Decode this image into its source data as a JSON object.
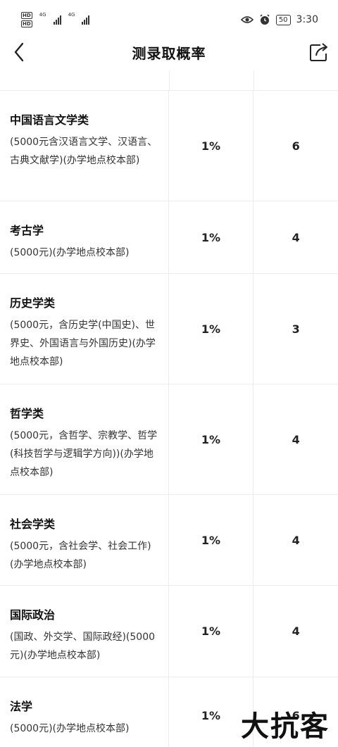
{
  "status_bar": {
    "hd1": "HD",
    "hd2": "HD",
    "net1": "4G",
    "net2": "4G",
    "battery": "50",
    "time": "3:30",
    "icons": [
      "eye-icon",
      "alarm-icon"
    ]
  },
  "header": {
    "title": "测录取概率",
    "back_icon": "chevron-left-icon",
    "share_icon": "share-icon"
  },
  "rows": [
    {
      "name": "中国语言文学类",
      "desc": "(5000元含汉语言文学、汉语言、古典文献学)(办学地点校本部)",
      "probability": "1%",
      "count": "6"
    },
    {
      "name": "考古学",
      "desc": "(5000元)(办学地点校本部)",
      "probability": "1%",
      "count": "4"
    },
    {
      "name": "历史学类",
      "desc": "(5000元，含历史学(中国史)、世界史、外国语言与外国历史)(办学地点校本部)",
      "probability": "1%",
      "count": "3"
    },
    {
      "name": "哲学类",
      "desc": "(5000元，含哲学、宗教学、哲学(科技哲学与逻辑学方向))(办学地点校本部)",
      "probability": "1%",
      "count": "4"
    },
    {
      "name": "社会学类",
      "desc": "(5000元，含社会学、社会工作)(办学地点校本部)",
      "probability": "1%",
      "count": "4"
    },
    {
      "name": "国际政治",
      "desc": "(国政、外交学、国际政经)(5000元)(办学地点校本部)",
      "probability": "1%",
      "count": "4"
    },
    {
      "name": "法学",
      "desc": "(5000元)(办学地点校本部)",
      "probability": "1%",
      "count": "6"
    }
  ],
  "watermark": "大抗客"
}
